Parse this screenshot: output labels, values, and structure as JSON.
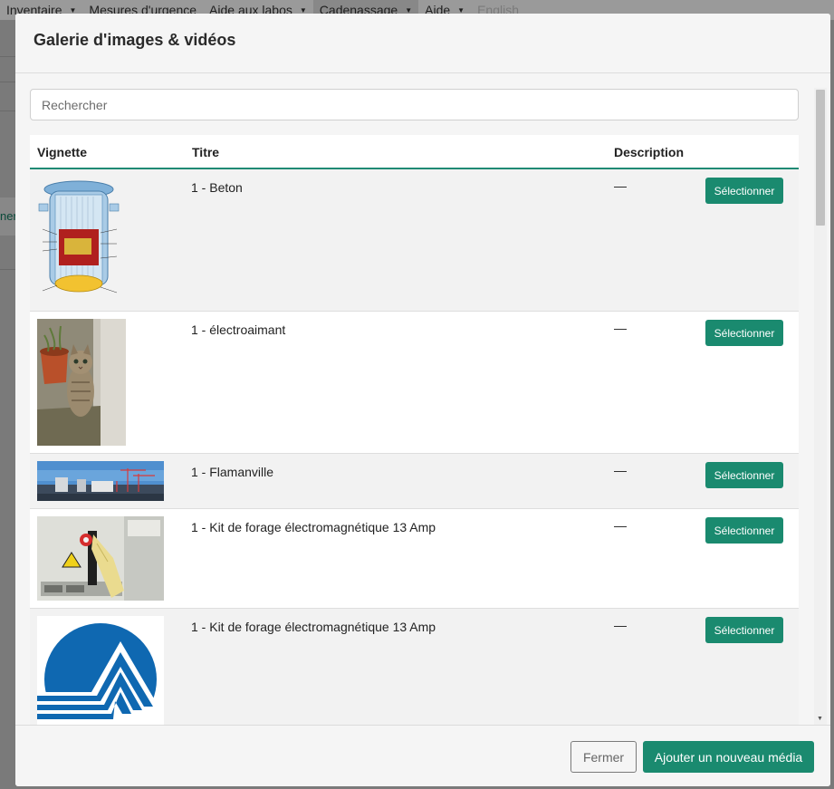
{
  "background_nav": {
    "items": [
      {
        "label": "Inventaire",
        "caret": "▼"
      },
      {
        "label": "Mesures d'urgence",
        "caret": ""
      },
      {
        "label": "Aide aux labos",
        "caret": "▼"
      },
      {
        "label": "Cadenassage",
        "caret": "▼"
      },
      {
        "label": "Aide",
        "caret": "▼"
      },
      {
        "label": "English",
        "caret": ""
      }
    ]
  },
  "background_left_fragment": "ner",
  "modal": {
    "title": "Galerie d'images & vidéos",
    "search_placeholder": "Rechercher",
    "columns": {
      "thumbnail": "Vignette",
      "title": "Titre",
      "description": "Description"
    },
    "rows": [
      {
        "title": "1 - Beton",
        "description": "—",
        "action": "Sélectionner",
        "thumbnail_icon": "reactor-diagram-image"
      },
      {
        "title": "1 - électroaimant",
        "description": "—",
        "action": "Sélectionner",
        "thumbnail_icon": "kitten-photo-image"
      },
      {
        "title": "1 - Flamanville",
        "description": "—",
        "action": "Sélectionner",
        "thumbnail_icon": "plant-panorama-image"
      },
      {
        "title": "1 - Kit de forage électromagnétique 13 Amp",
        "description": "—",
        "action": "Sélectionner",
        "thumbnail_icon": "lockout-panel-image"
      },
      {
        "title": "1 - Kit de forage électromagnétique 13 Amp",
        "description": "—",
        "action": "Sélectionner",
        "thumbnail_icon": "blue-logo-image"
      }
    ],
    "footer": {
      "close_label": "Fermer",
      "add_label": "Ajouter un nouveau média"
    }
  },
  "colors": {
    "accent": "#1a8a6f",
    "header_rule": "#1f8a74"
  }
}
